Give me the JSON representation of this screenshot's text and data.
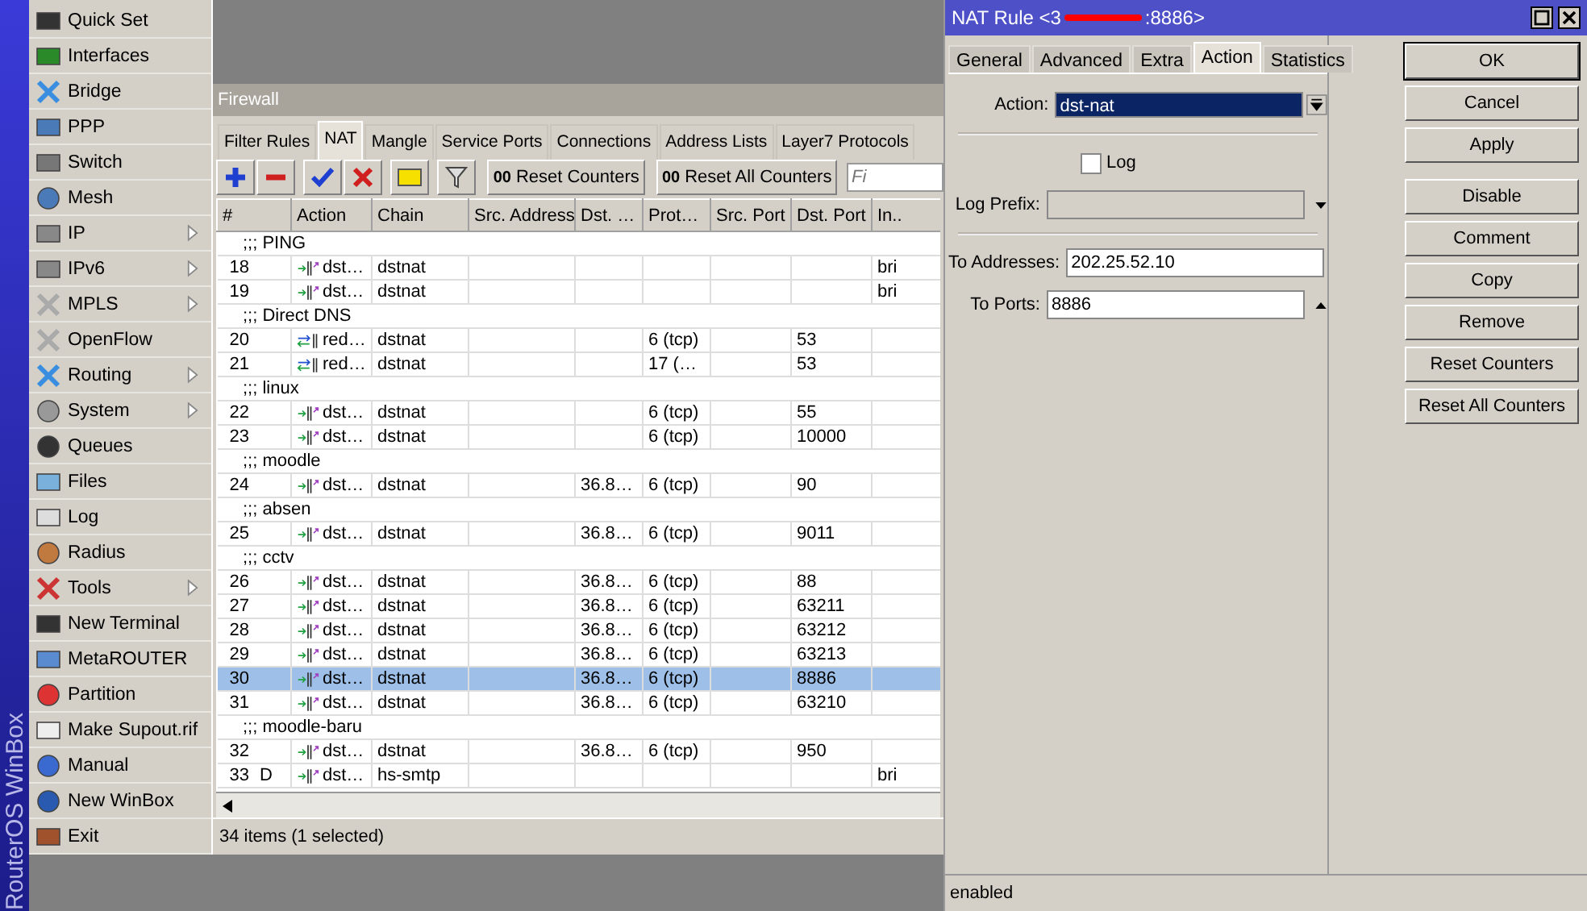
{
  "sidebar": {
    "brand": "RouterOS WinBox",
    "items": [
      {
        "label": "Quick Set",
        "submenu": false
      },
      {
        "label": "Interfaces",
        "submenu": false
      },
      {
        "label": "Bridge",
        "submenu": false
      },
      {
        "label": "PPP",
        "submenu": false
      },
      {
        "label": "Switch",
        "submenu": false
      },
      {
        "label": "Mesh",
        "submenu": false
      },
      {
        "label": "IP",
        "submenu": true
      },
      {
        "label": "IPv6",
        "submenu": true
      },
      {
        "label": "MPLS",
        "submenu": true
      },
      {
        "label": "OpenFlow",
        "submenu": false
      },
      {
        "label": "Routing",
        "submenu": true
      },
      {
        "label": "System",
        "submenu": true
      },
      {
        "label": "Queues",
        "submenu": false
      },
      {
        "label": "Files",
        "submenu": false
      },
      {
        "label": "Log",
        "submenu": false
      },
      {
        "label": "Radius",
        "submenu": false
      },
      {
        "label": "Tools",
        "submenu": true
      },
      {
        "label": "New Terminal",
        "submenu": false
      },
      {
        "label": "MetaROUTER",
        "submenu": false
      },
      {
        "label": "Partition",
        "submenu": false
      },
      {
        "label": "Make Supout.rif",
        "submenu": false
      },
      {
        "label": "Manual",
        "submenu": false
      },
      {
        "label": "New WinBox",
        "submenu": false
      },
      {
        "label": "Exit",
        "submenu": false
      }
    ]
  },
  "firewall": {
    "title": "Firewall",
    "tabs": [
      {
        "label": "Filter Rules",
        "selected": false
      },
      {
        "label": "NAT",
        "selected": true
      },
      {
        "label": "Mangle",
        "selected": false
      },
      {
        "label": "Service Ports",
        "selected": false
      },
      {
        "label": "Connections",
        "selected": false
      },
      {
        "label": "Address Lists",
        "selected": false
      },
      {
        "label": "Layer7 Protocols",
        "selected": false
      }
    ],
    "toolbar": {
      "counter_buttons": [
        {
          "icon_text": "00",
          "label": "Reset Counters"
        },
        {
          "icon_text": "00",
          "label": "Reset All Counters"
        }
      ],
      "find_placeholder": "Fi"
    },
    "table": {
      "columns": [
        "#",
        "Action",
        "Chain",
        "Src. Address",
        "Dst. …",
        "Prot…",
        "Src. Port",
        "Dst. Port",
        "In.."
      ],
      "rows": [
        {
          "kind": "comment",
          "text": ";;; PING"
        },
        {
          "kind": "rule",
          "num": "18",
          "redirect": false,
          "action": "dst…",
          "chain": "dstnat",
          "in_interface": "bri",
          "selected": false
        },
        {
          "kind": "rule",
          "num": "19",
          "redirect": false,
          "action": "dst…",
          "chain": "dstnat",
          "in_interface": "bri",
          "selected": false
        },
        {
          "kind": "comment",
          "text": ";;; Direct DNS"
        },
        {
          "kind": "rule",
          "num": "20",
          "redirect": true,
          "action": "red…",
          "chain": "dstnat",
          "protocol": "6 (tcp)",
          "dst_port": "53",
          "selected": false
        },
        {
          "kind": "rule",
          "num": "21",
          "redirect": true,
          "action": "red…",
          "chain": "dstnat",
          "protocol": "17 (…",
          "dst_port": "53",
          "selected": false
        },
        {
          "kind": "comment",
          "text": ";;; linux"
        },
        {
          "kind": "rule",
          "num": "22",
          "redirect": false,
          "action": "dst…",
          "chain": "dstnat",
          "protocol": "6 (tcp)",
          "dst_port": "55",
          "selected": false
        },
        {
          "kind": "rule",
          "num": "23",
          "redirect": false,
          "action": "dst…",
          "chain": "dstnat",
          "protocol": "6 (tcp)",
          "dst_port": "10000",
          "selected": false
        },
        {
          "kind": "comment",
          "text": ";;; moodle"
        },
        {
          "kind": "rule",
          "num": "24",
          "redirect": false,
          "action": "dst…",
          "chain": "dstnat",
          "dst_address": "36.8…",
          "protocol": "6 (tcp)",
          "dst_port": "90",
          "selected": false
        },
        {
          "kind": "comment",
          "text": ";;; absen"
        },
        {
          "kind": "rule",
          "num": "25",
          "redirect": false,
          "action": "dst…",
          "chain": "dstnat",
          "dst_address": "36.8…",
          "protocol": "6 (tcp)",
          "dst_port": "9011",
          "selected": false
        },
        {
          "kind": "comment",
          "text": ";;; cctv"
        },
        {
          "kind": "rule",
          "num": "26",
          "redirect": false,
          "action": "dst…",
          "chain": "dstnat",
          "dst_address": "36.8…",
          "protocol": "6 (tcp)",
          "dst_port": "88",
          "selected": false
        },
        {
          "kind": "rule",
          "num": "27",
          "redirect": false,
          "action": "dst…",
          "chain": "dstnat",
          "dst_address": "36.8…",
          "protocol": "6 (tcp)",
          "dst_port": "63211",
          "selected": false
        },
        {
          "kind": "rule",
          "num": "28",
          "redirect": false,
          "action": "dst…",
          "chain": "dstnat",
          "dst_address": "36.8…",
          "protocol": "6 (tcp)",
          "dst_port": "63212",
          "selected": false
        },
        {
          "kind": "rule",
          "num": "29",
          "redirect": false,
          "action": "dst…",
          "chain": "dstnat",
          "dst_address": "36.8…",
          "protocol": "6 (tcp)",
          "dst_port": "63213",
          "selected": false
        },
        {
          "kind": "rule",
          "num": "30",
          "redirect": false,
          "action": "dst…",
          "chain": "dstnat",
          "dst_address": "36.8…",
          "protocol": "6 (tcp)",
          "dst_port": "8886",
          "selected": true
        },
        {
          "kind": "rule",
          "num": "31",
          "redirect": false,
          "action": "dst…",
          "chain": "dstnat",
          "dst_address": "36.8…",
          "protocol": "6 (tcp)",
          "dst_port": "63210",
          "selected": false
        },
        {
          "kind": "comment",
          "text": ";;; moodle-baru"
        },
        {
          "kind": "rule",
          "num": "32",
          "redirect": false,
          "action": "dst…",
          "chain": "dstnat",
          "dst_address": "36.8…",
          "protocol": "6 (tcp)",
          "dst_port": "950",
          "selected": false
        },
        {
          "kind": "rule",
          "num": "33",
          "flag": "D",
          "redirect": false,
          "action": "dst…",
          "chain": "hs-smtp",
          "in_interface": "bri",
          "selected": false
        }
      ]
    },
    "status": "34 items (1 selected)"
  },
  "dialog": {
    "title_start": "NAT Rule <3",
    "title_end": ":8886>",
    "tabs": [
      {
        "label": "General",
        "selected": false
      },
      {
        "label": "Advanced",
        "selected": false
      },
      {
        "label": "Extra",
        "selected": false
      },
      {
        "label": "Action",
        "selected": true
      },
      {
        "label": "Statistics",
        "selected": false
      }
    ],
    "action": {
      "label": "Action:",
      "value": "dst-nat"
    },
    "log": {
      "label": "Log",
      "checked": false
    },
    "log_prefix": {
      "label": "Log Prefix:"
    },
    "to_addresses": {
      "label": "To Addresses:",
      "value": "202.25.52.10"
    },
    "to_ports": {
      "label": "To Ports:",
      "value": "8886"
    },
    "buttons": [
      {
        "label": "OK",
        "default": true
      },
      {
        "label": "Cancel",
        "default": false
      },
      {
        "label": "Apply",
        "default": false
      },
      {
        "label": "Disable",
        "default": false
      },
      {
        "label": "Comment",
        "default": false
      },
      {
        "label": "Copy",
        "default": false
      },
      {
        "label": "Remove",
        "default": false
      },
      {
        "label": "Reset Counters",
        "default": false
      },
      {
        "label": "Reset All Counters",
        "default": false
      }
    ],
    "status": "enabled"
  }
}
